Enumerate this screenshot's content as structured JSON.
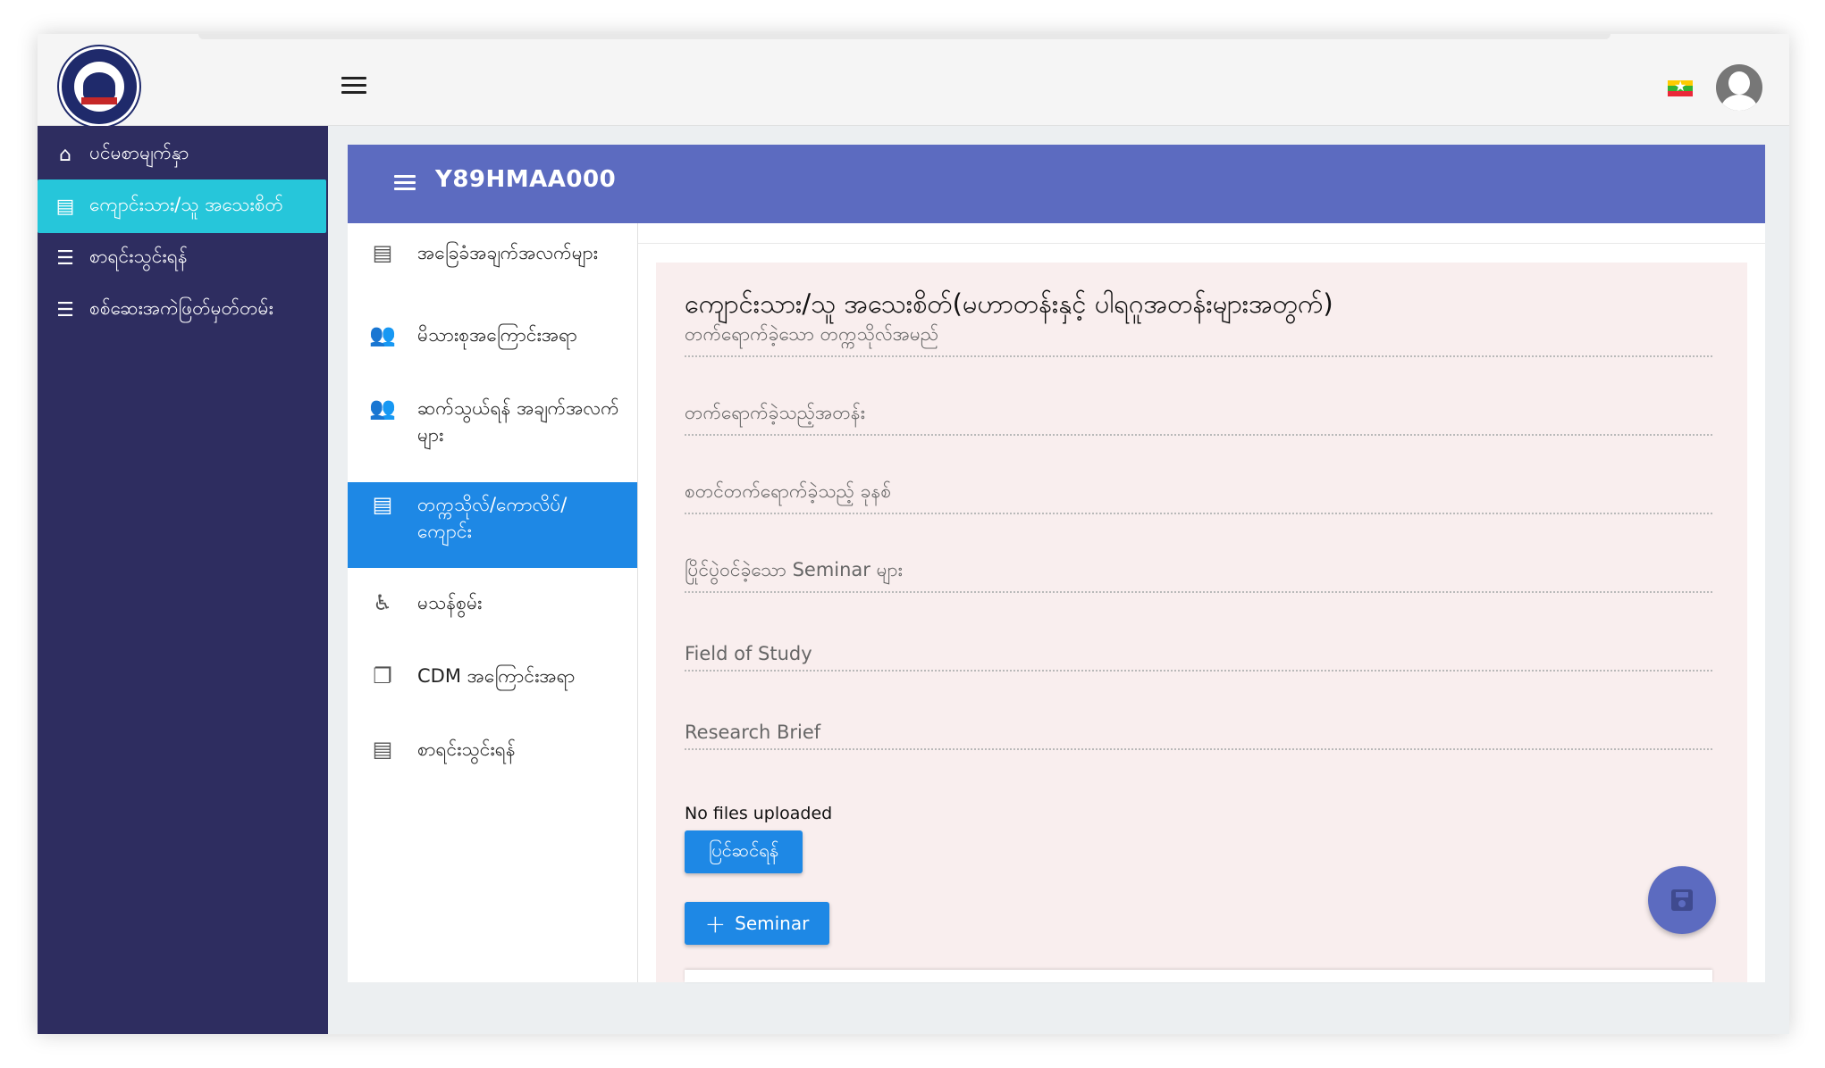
{
  "topbar": {
    "logo_icon": "university-logo",
    "menu_icon": "hamburger-menu-icon",
    "flag_icon": "myanmar-flag-icon",
    "avatar_icon": "user-avatar-icon"
  },
  "sidebar": {
    "items": [
      {
        "label": "ပင်မစာမျက်နှာ",
        "icon": "home-icon",
        "active": false
      },
      {
        "label": "ကျောင်းသား/သူ အသေးစိတ်",
        "icon": "news-icon",
        "active": true
      },
      {
        "label": "စာရင်းသွင်းရန်",
        "icon": "list-icon",
        "active": false
      },
      {
        "label": "စစ်ဆေးအကဲဖြတ်မှတ်တမ်း",
        "icon": "list-icon",
        "active": false
      }
    ]
  },
  "content": {
    "title": "Y89HMAA000",
    "tabs": [
      {
        "label": "အခြေခံအချက်အလက်များ",
        "icon": "document-icon",
        "active": false
      },
      {
        "label": "မိသားစုအကြောင်းအရာ",
        "icon": "add-person-icon",
        "active": false
      },
      {
        "label": "ဆက်သွယ်ရန် အချက်အလက်များ",
        "icon": "add-person-icon",
        "active": false
      },
      {
        "label": "တက္ကသိုလ်/ကောလိပ်/ ကျောင်း",
        "icon": "news-icon",
        "active": true
      },
      {
        "label": "မသန်စွမ်း",
        "icon": "accessibility-icon",
        "active": false
      },
      {
        "label": "CDM အကြောင်းအရာ",
        "icon": "file-copy-icon",
        "active": false
      },
      {
        "label": "စာရင်းသွင်းရန်",
        "icon": "document-icon",
        "active": false
      }
    ],
    "form": {
      "heading": "ကျောင်းသား/သူ အသေးစိတ်(မဟာတန်းနှင့် ပါရဂူအတန်းများအတွက်)",
      "fields": [
        {
          "label": "တက်ရောက်ခဲ့သော တက္ကသိုလ်အမည်",
          "value": ""
        },
        {
          "label": "တက်ရောက်ခဲ့သည့်အတန်း",
          "value": ""
        },
        {
          "label": "စတင်တက်ရောက်ခဲ့သည့် ခုနစ်",
          "value": ""
        },
        {
          "label": "ပြိုင်ပွဲဝင်ခဲ့သော Seminar များ",
          "value": ""
        },
        {
          "label": "Field of Study",
          "value": ""
        },
        {
          "label": "Research Brief",
          "value": ""
        }
      ],
      "no_files_text": "No files uploaded",
      "edit_button": "ပြင်ဆင်ရန်",
      "seminar_button": "Seminar",
      "save_icon": "save-icon"
    }
  },
  "colors": {
    "sidebar_bg": "#2e2d60",
    "sidebar_active": "#26c6da",
    "header_bg": "#5c6bc0",
    "tab_active": "#1e88e5",
    "form_bg": "#f9eeee",
    "button_bg": "#1e88e5"
  }
}
